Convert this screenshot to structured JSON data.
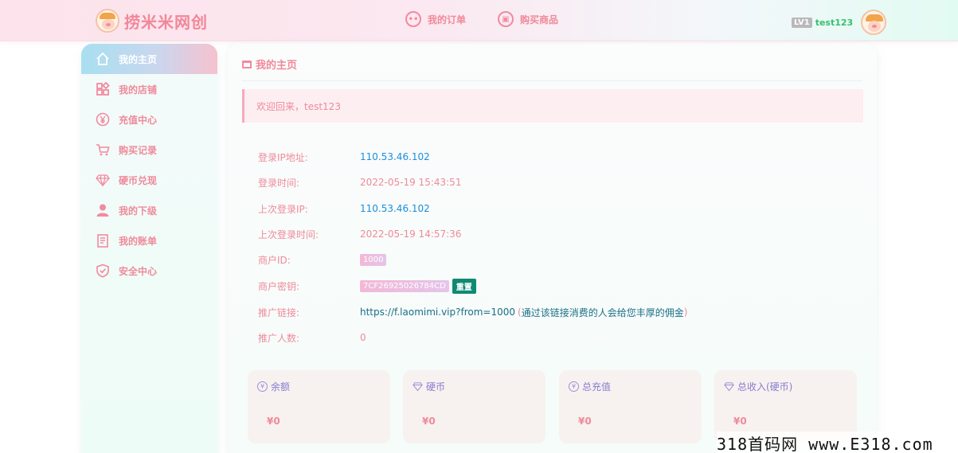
{
  "header": {
    "brand_name": "捞米米网创",
    "nav": [
      {
        "label": "我的订单",
        "icon": "chat-icon"
      },
      {
        "label": "购买商品",
        "icon": "shop-icon"
      }
    ],
    "level_badge": "LV1",
    "username": "test123"
  },
  "sidebar": {
    "items": [
      {
        "label": "我的主页",
        "icon": "home-icon",
        "active": true
      },
      {
        "label": "我的店铺",
        "icon": "grid-icon"
      },
      {
        "label": "充值中心",
        "icon": "yen-icon"
      },
      {
        "label": "购买记录",
        "icon": "cart-icon"
      },
      {
        "label": "硬币兑现",
        "icon": "diamond-icon"
      },
      {
        "label": "我的下级",
        "icon": "user-icon"
      },
      {
        "label": "我的账单",
        "icon": "bill-icon"
      },
      {
        "label": "安全中心",
        "icon": "shield-icon"
      }
    ]
  },
  "main": {
    "title": "我的主页",
    "welcome": "欢迎回来，test123",
    "info": {
      "login_ip_label": "登录IP地址:",
      "login_ip": "110.53.46.102",
      "login_time_label": "登录时间:",
      "login_time": "2022-05-19 15:43:51",
      "last_ip_label": "上次登录IP:",
      "last_ip": "110.53.46.102",
      "last_time_label": "上次登录时间:",
      "last_time": "2022-05-19 14:57:36",
      "merchant_id_label": "商户ID:",
      "merchant_id": "1000",
      "merchant_key_label": "商户密钥:",
      "merchant_key": "7CF26925026784CD",
      "reset_label": "重置",
      "promo_label": "推广链接:",
      "promo_link": "https://f.laomimi.vip?from=1000",
      "promo_note_open": "(",
      "promo_note": "通过该链接消费的人会给您丰厚的佣金",
      "promo_note_close": ")",
      "promo_count_label": "推广人数:",
      "promo_count": "0"
    },
    "stats": [
      {
        "label": "余额",
        "value": "¥0",
        "icon": "yen-icon"
      },
      {
        "label": "硬币",
        "value": "¥0",
        "icon": "diamond-icon"
      },
      {
        "label": "总充值",
        "value": "¥0",
        "icon": "yen-icon"
      },
      {
        "label": "总收入(硬币)",
        "value": "¥0",
        "icon": "diamond-icon"
      }
    ]
  },
  "watermark": "318首码网 www.E318.com"
}
